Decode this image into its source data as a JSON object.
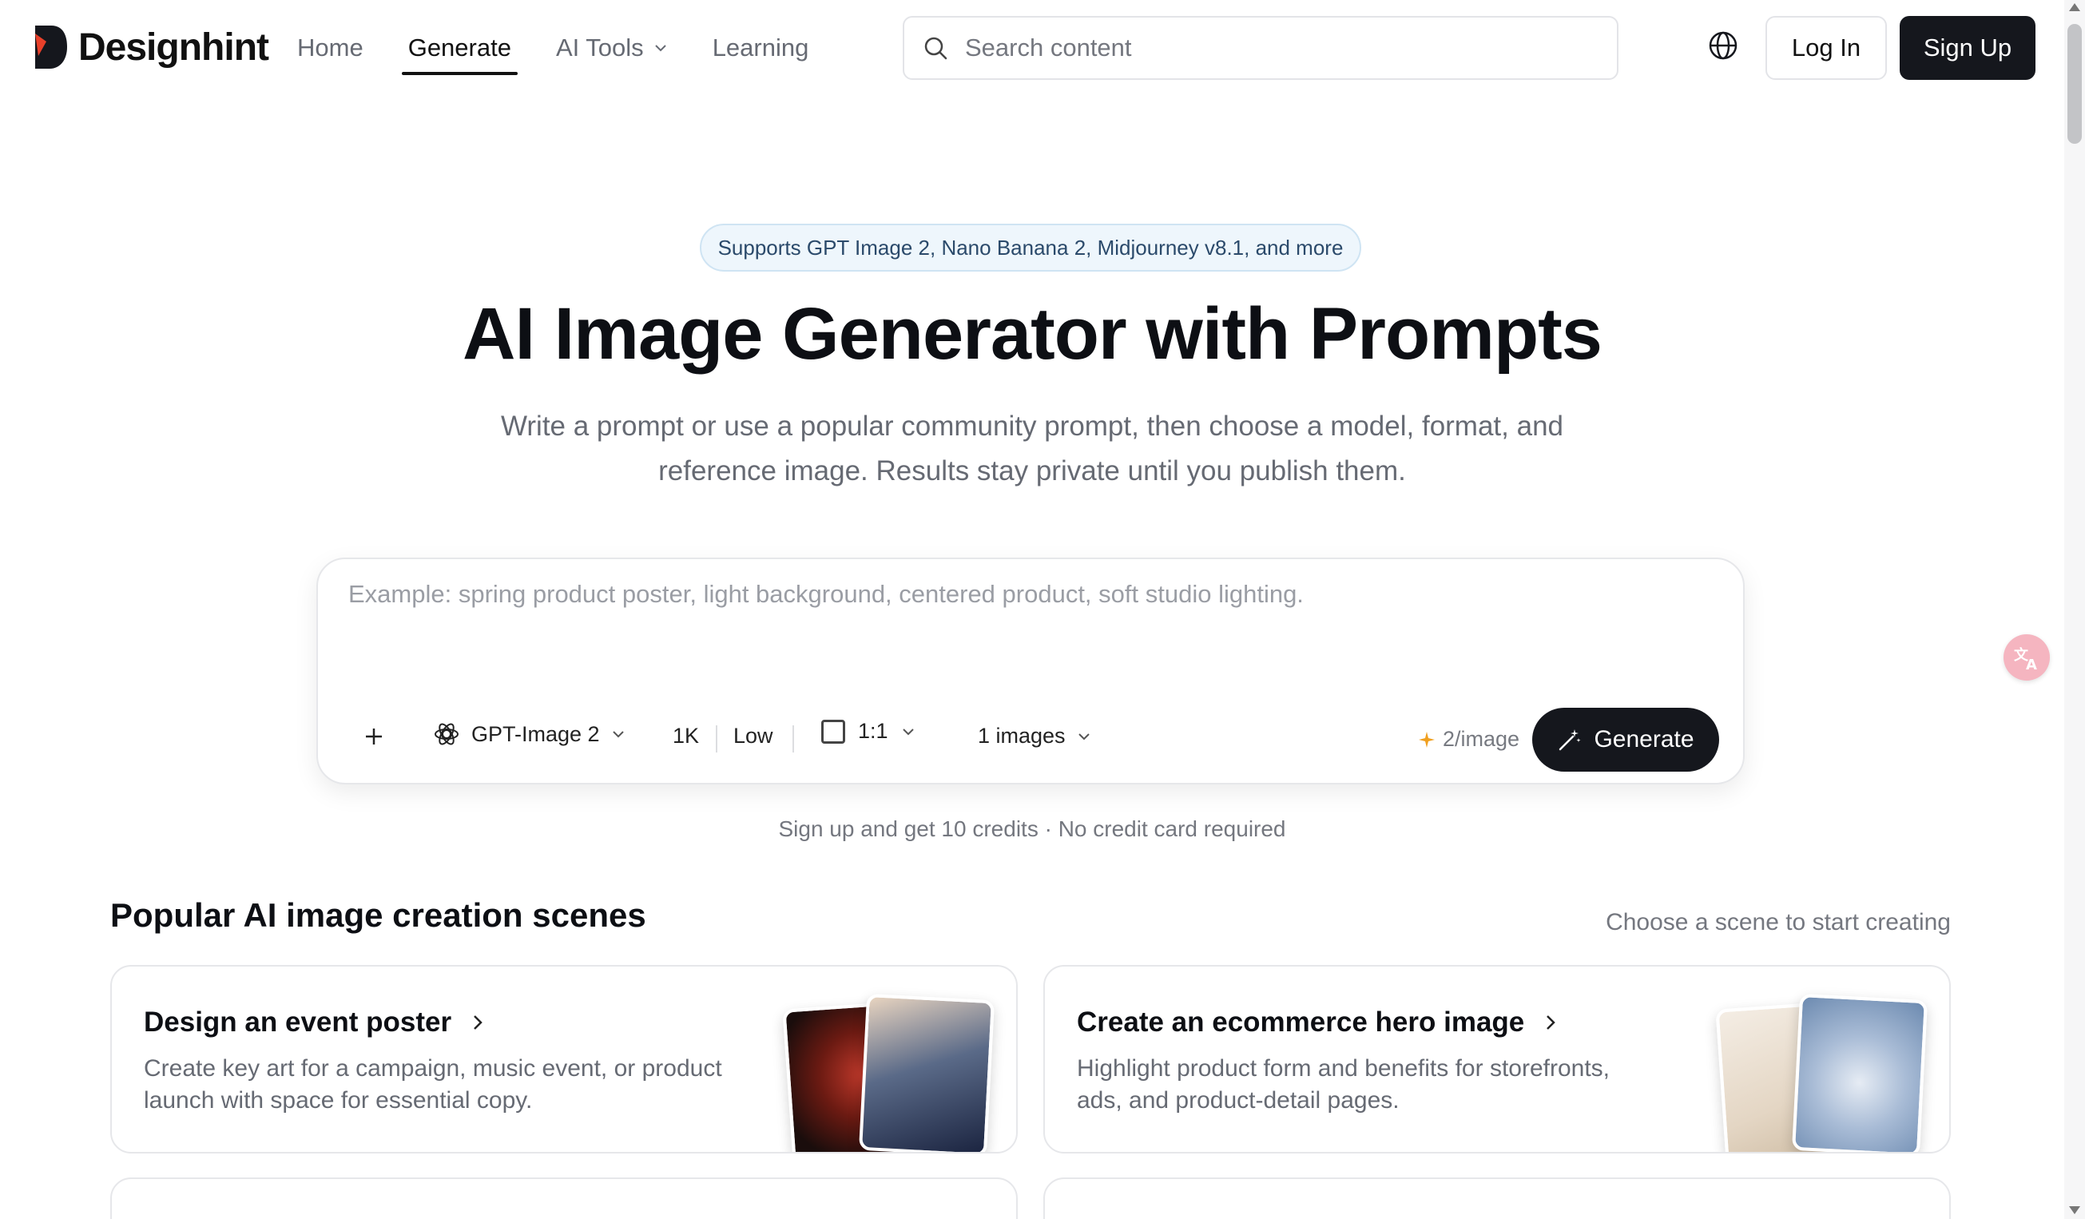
{
  "brand": {
    "name": "Designhint"
  },
  "nav": {
    "home": "Home",
    "generate": "Generate",
    "ai_tools": "AI Tools",
    "learning": "Learning"
  },
  "search": {
    "placeholder": "Search content"
  },
  "auth": {
    "login": "Log In",
    "signup": "Sign Up"
  },
  "hero": {
    "badge": "Supports GPT Image 2, Nano Banana 2, Midjourney v8.1, and more",
    "title": "AI Image Generator with Prompts",
    "subtitle_line1": "Write a prompt or use a popular community prompt, then choose a model, format, and",
    "subtitle_line2": "reference image. Results stay private until you publish them."
  },
  "prompt": {
    "placeholder": "Example: spring product poster, light background, centered product, soft studio lighting.",
    "model": "GPT-Image 2",
    "resolution": "1K",
    "quality": "Low",
    "ratio": "1:1",
    "images": "1 images",
    "cost": "2/image",
    "generate": "Generate"
  },
  "signup_note": "Sign up and get 10 credits · No credit card required",
  "scenes": {
    "title": "Popular AI image creation scenes",
    "hint": "Choose a scene to start creating",
    "items": [
      {
        "title": "Design an event poster",
        "desc_line1": "Create key art for a campaign, music event, or product",
        "desc_line2": "launch with space for essential copy."
      },
      {
        "title": "Create an ecommerce hero image",
        "desc_line1": "Highlight product form and benefits for storefronts,",
        "desc_line2": "ads, and product-detail pages."
      }
    ]
  },
  "colors": {
    "primary": "#15171d",
    "badge_bg": "#eef6fc",
    "badge_border": "#cfe4f3",
    "logo_accent": "#e8402a",
    "credit_star": "#f0a020"
  }
}
